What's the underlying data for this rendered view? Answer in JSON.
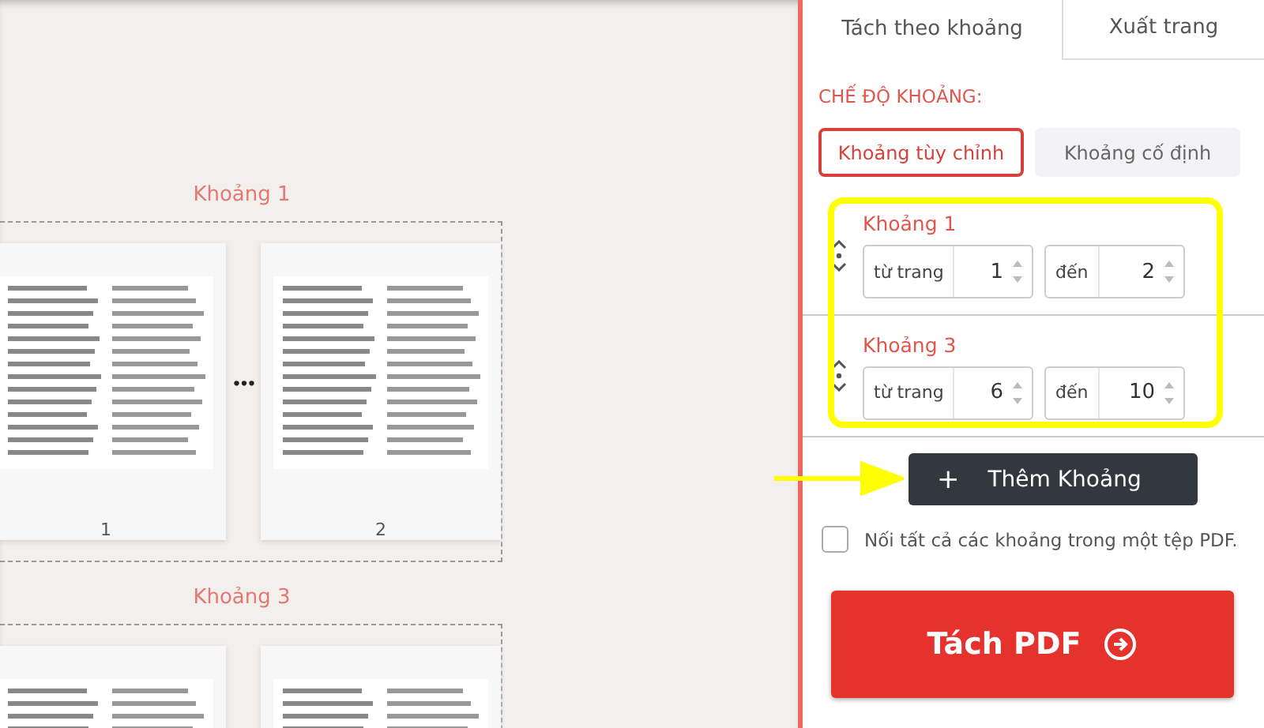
{
  "canvas": {
    "groups": [
      {
        "title": "Khoảng 1",
        "pages": [
          {
            "kind": "document",
            "number": "1"
          },
          {
            "kind": "document",
            "number": "2"
          }
        ],
        "between": "•••"
      },
      {
        "title": "Khoảng 3",
        "pages": [
          {
            "kind": "document"
          },
          {
            "kind": "document"
          }
        ]
      }
    ]
  },
  "panel": {
    "tabs": [
      {
        "label": "Tách theo khoảng",
        "selected": true
      },
      {
        "label": "Xuất trang",
        "selected": false
      }
    ],
    "mode_label": "CHẾ ĐỘ KHOẢNG:",
    "modes": [
      {
        "label": "Khoảng tùy chỉnh",
        "selected": true
      },
      {
        "label": "Khoảng cố định",
        "selected": false
      }
    ],
    "ranges": [
      {
        "title": "Khoảng 1",
        "from_label": "từ trang",
        "from_value": "1",
        "to_label": "đến",
        "to_value": "2"
      },
      {
        "title": "Khoảng 3",
        "from_label": "từ trang",
        "from_value": "6",
        "to_label": "đến",
        "to_value": "10"
      }
    ],
    "add_button": {
      "icon": "+",
      "label": "Thêm Khoảng"
    },
    "merge": {
      "label": "Nối tất cả các khoảng trong một tệp PDF.",
      "checked": false
    },
    "split_button": {
      "label": "Tách PDF"
    }
  }
}
